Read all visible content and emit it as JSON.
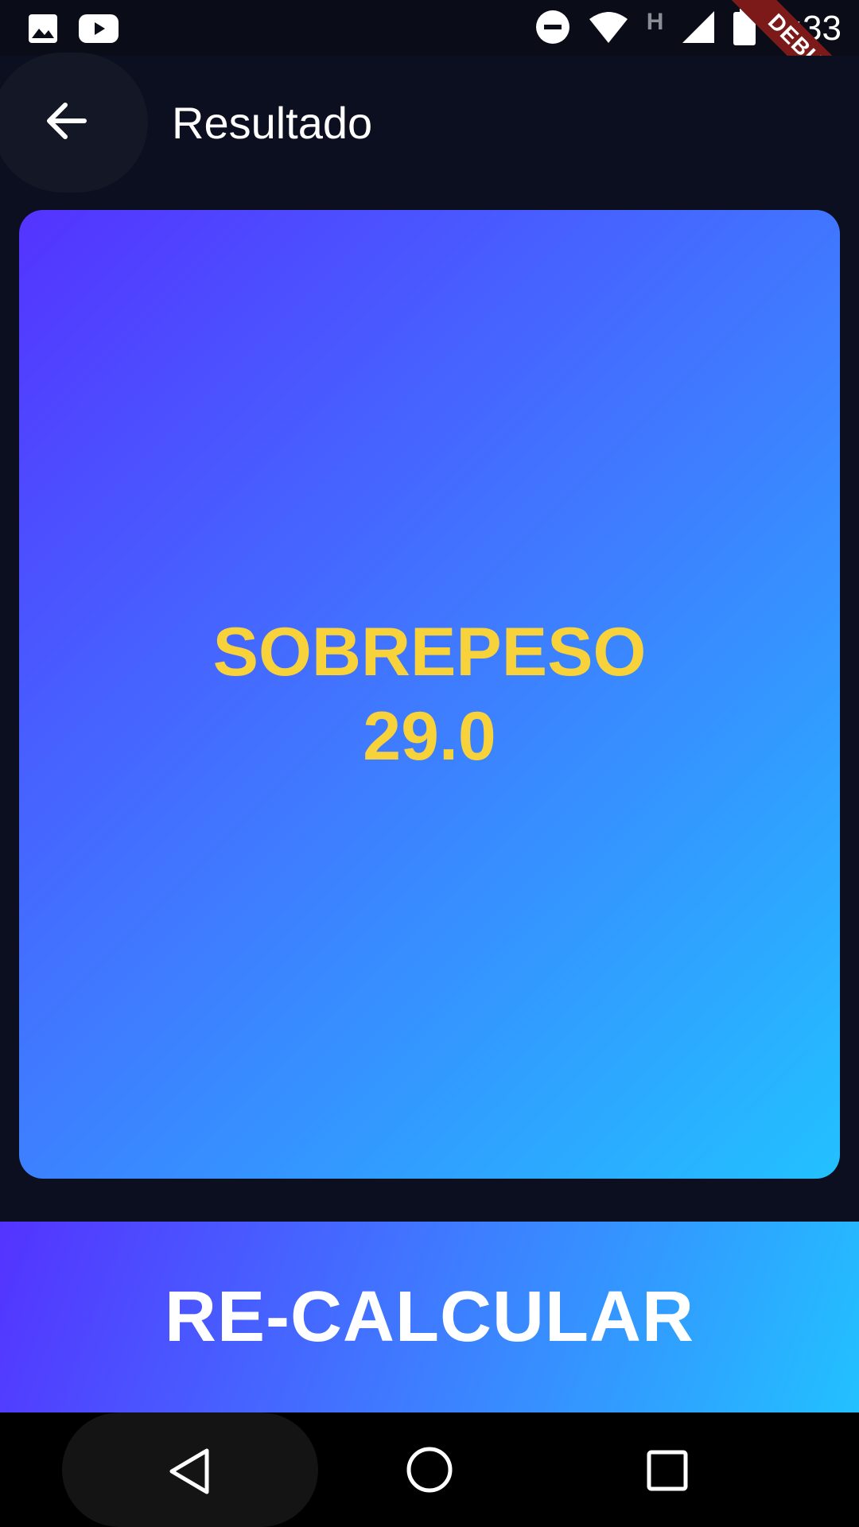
{
  "status_bar": {
    "time": "2:33",
    "left_icons": [
      "image-icon",
      "youtube-icon"
    ],
    "right_icons": [
      "do-not-disturb-icon",
      "wifi-icon",
      "h-network-icon",
      "cell-signal-icon",
      "battery-icon"
    ],
    "network_letter": "H"
  },
  "debug_banner": {
    "label": "DEBUG",
    "color": "#7c1a1a"
  },
  "app_bar": {
    "title": "Resultado",
    "back_icon": "arrow-back-icon"
  },
  "result": {
    "label": "SOBREPESO",
    "value": "29.0",
    "text_color": "#f7d23a",
    "gradient": [
      "#5433ff",
      "#3f7bff",
      "#22c1ff"
    ]
  },
  "recalculate_button": {
    "label": "RE-CALCULAR"
  },
  "nav_bar": {
    "icons": [
      "back-triangle-icon",
      "home-circle-icon",
      "recents-square-icon"
    ]
  },
  "colors": {
    "background": "#0b0f1f",
    "text": "#ffffff"
  }
}
